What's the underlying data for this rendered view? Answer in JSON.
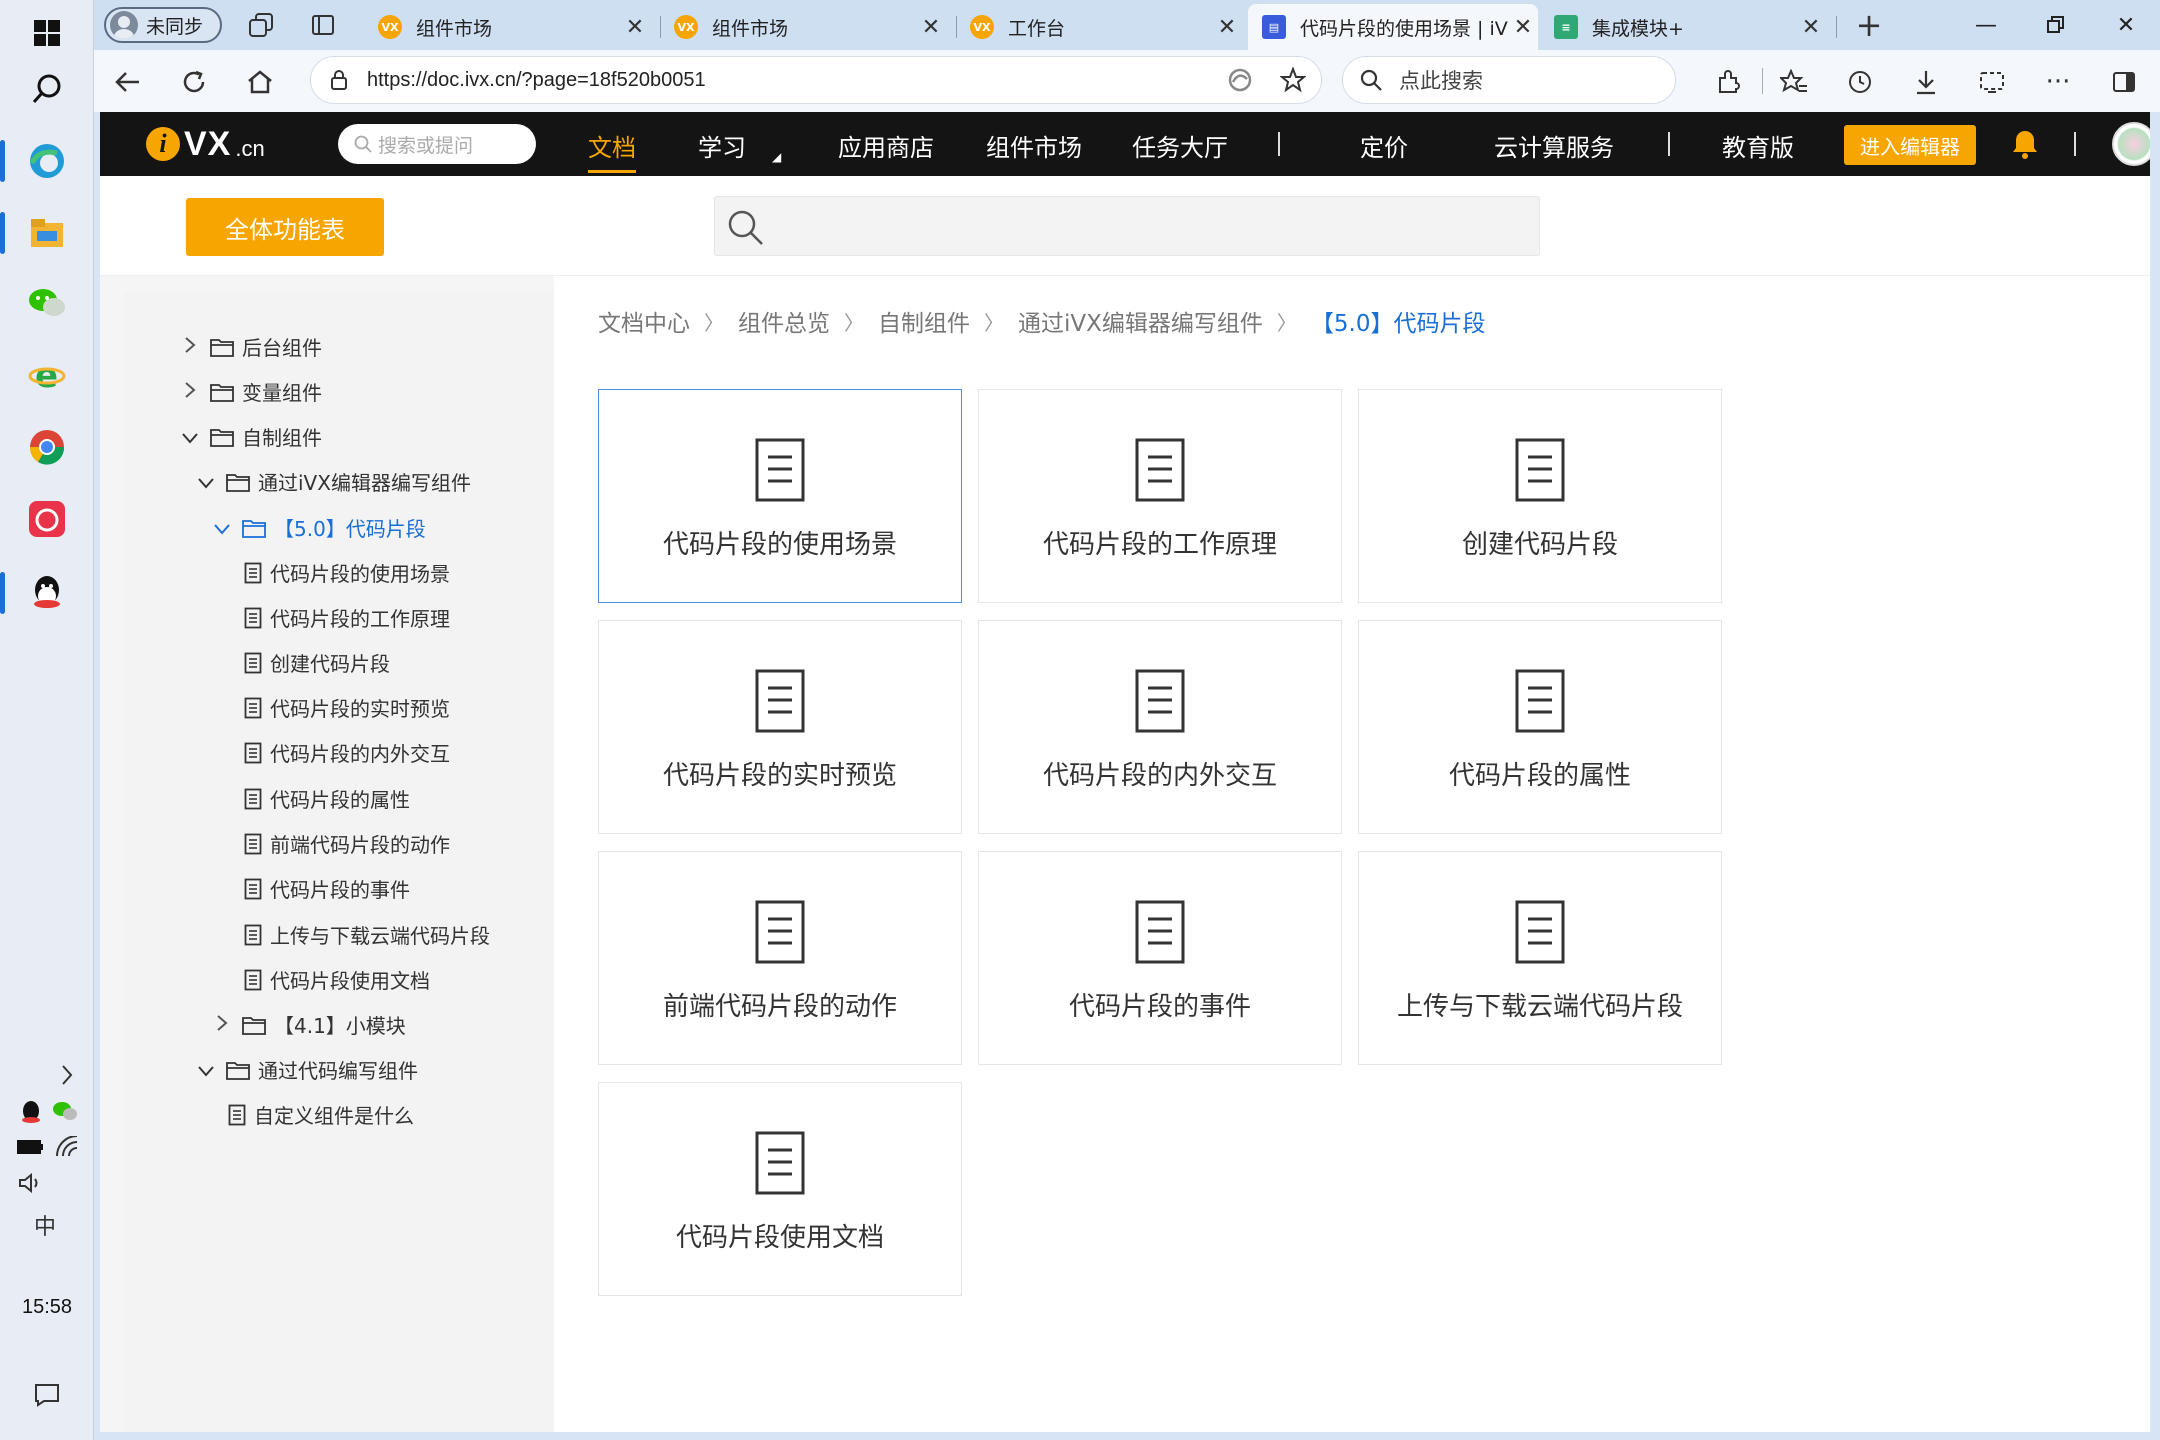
{
  "taskbar": {
    "clock": "15:58",
    "ime": "中",
    "apps": [
      "windows-start",
      "search",
      "edge",
      "file-explorer",
      "wechat",
      "ie",
      "chrome",
      "app-red",
      "qq"
    ]
  },
  "browser": {
    "profile_label": "未同步",
    "tabs": [
      {
        "title": "组件市场",
        "icon": "ivx"
      },
      {
        "title": "组件市场",
        "icon": "ivx"
      },
      {
        "title": "工作台",
        "icon": "ivx"
      },
      {
        "title": "代码片段的使用场景 | iVX",
        "icon": "doc",
        "active": true
      },
      {
        "title": "集成模块+",
        "icon": "green"
      }
    ],
    "url": "https://doc.ivx.cn/?page=18f520b0051",
    "search_placeholder": "点此搜索"
  },
  "site": {
    "logo_text": "VX",
    "logo_cn": ".cn",
    "search_placeholder": "搜索或提问",
    "nav": {
      "docs": "文档",
      "learn": "学习",
      "app_store": "应用商店",
      "component_market": "组件市场",
      "task_hall": "任务大厅",
      "pricing": "定价",
      "cloud": "云计算服务",
      "edu": "教育版"
    },
    "editor_button": "进入编辑器",
    "all_features": "全体功能表"
  },
  "sidebar": {
    "items": [
      {
        "label": "后台组件"
      },
      {
        "label": "变量组件"
      },
      {
        "label": "自制组件"
      },
      {
        "label": "通过iVX编辑器编写组件"
      },
      {
        "label": "【5.0】代码片段"
      },
      {
        "label": "代码片段的使用场景"
      },
      {
        "label": "代码片段的工作原理"
      },
      {
        "label": "创建代码片段"
      },
      {
        "label": "代码片段的实时预览"
      },
      {
        "label": "代码片段的内外交互"
      },
      {
        "label": "代码片段的属性"
      },
      {
        "label": "前端代码片段的动作"
      },
      {
        "label": "代码片段的事件"
      },
      {
        "label": "上传与下载云端代码片段"
      },
      {
        "label": "代码片段使用文档"
      },
      {
        "label": "【4.1】小模块"
      },
      {
        "label": "通过代码编写组件"
      },
      {
        "label": "自定义组件是什么"
      }
    ]
  },
  "breadcrumb": [
    "文档中心",
    "组件总览",
    "自制组件",
    "通过iVX编辑器编写组件",
    "【5.0】代码片段"
  ],
  "cards": [
    {
      "label": "代码片段的使用场景"
    },
    {
      "label": "代码片段的工作原理"
    },
    {
      "label": "创建代码片段"
    },
    {
      "label": "代码片段的实时预览"
    },
    {
      "label": "代码片段的内外交互"
    },
    {
      "label": "代码片段的属性"
    },
    {
      "label": "前端代码片段的动作"
    },
    {
      "label": "代码片段的事件"
    },
    {
      "label": "上传与下载云端代码片段"
    },
    {
      "label": "代码片段使用文档"
    }
  ],
  "colors": {
    "accent": "#f7a500",
    "link": "#1a6fd6",
    "header_bg": "#141414"
  }
}
